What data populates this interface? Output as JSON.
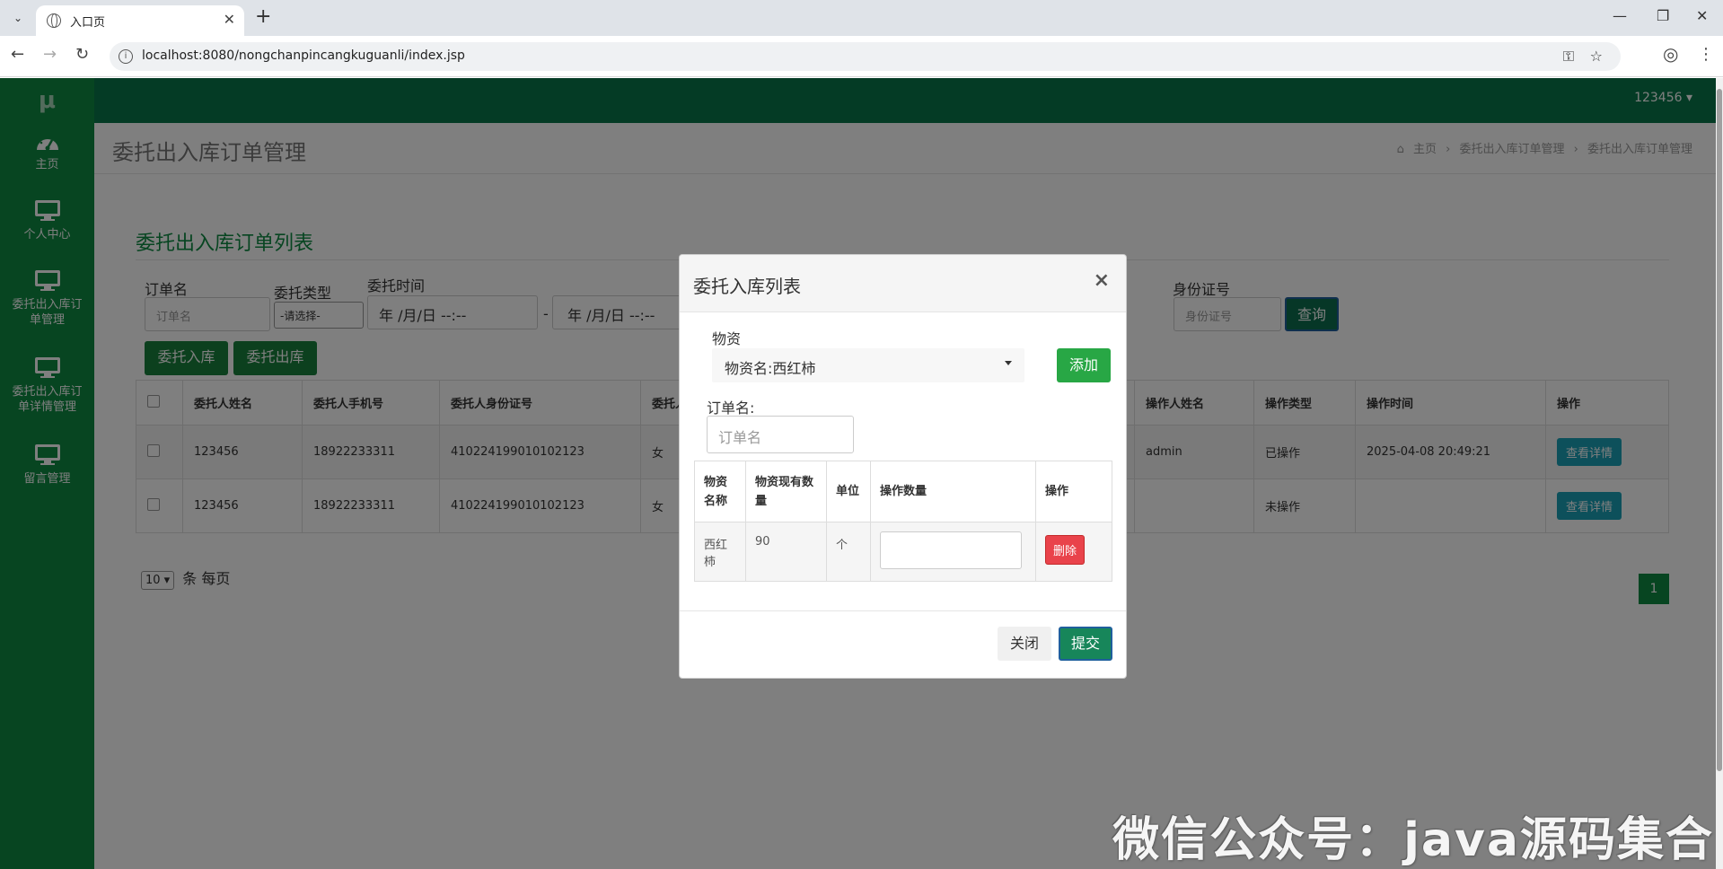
{
  "browser": {
    "tab_title": "入口页",
    "url": "localhost:8080/nongchanpincangkuguanli/index.jsp"
  },
  "sidebar": {
    "logo": "μ",
    "items": [
      {
        "label": "主页"
      },
      {
        "label": "个人中心"
      },
      {
        "label": "委托出入库订单管理"
      },
      {
        "label": "委托出入库订单详情管理"
      },
      {
        "label": "留言管理"
      }
    ]
  },
  "header": {
    "username": "123456 ▾"
  },
  "page": {
    "title": "委托出入库订单管理",
    "breadcrumb": [
      "主页",
      "委托出入库订单管理",
      "委托出入库订单管理"
    ]
  },
  "panel": {
    "title": "委托出入库订单列表",
    "filters": {
      "order_label": "订单名",
      "order_placeholder": "订单名",
      "type_label": "委托类型",
      "type_value": "-请选择-",
      "time_label": "委托时间",
      "time_start": "年 /月/日  --:--",
      "time_end": "年 /月/日  --:--",
      "time_sep": "-",
      "idcard_label": "身份证号",
      "idcard_placeholder": "身份证号",
      "query": "查询"
    },
    "actions": {
      "in": "委托入库",
      "out": "委托出库"
    },
    "columns": [
      "委托人姓名",
      "委托人手机号",
      "委托人身份证号",
      "委托人",
      "操作人姓名",
      "操作类型",
      "操作时间",
      "操作"
    ],
    "rows": [
      {
        "name": "123456",
        "phone": "18922233311",
        "idcard": "410224199010102123",
        "gender": "女",
        "operator": "admin",
        "op_type": "已操作",
        "op_time": "2025-04-08 20:49:21",
        "action": "查看详情"
      },
      {
        "name": "123456",
        "phone": "18922233311",
        "idcard": "410224199010102123",
        "gender": "女",
        "operator": "",
        "op_type": "未操作",
        "op_time": "",
        "action": "查看详情"
      }
    ],
    "pager": {
      "size": "10 ▾",
      "suffix": "条 每页",
      "page": "1"
    }
  },
  "modal": {
    "title": "委托入库列表",
    "material_label": "物资",
    "material_value": "物资名:西红柿",
    "add": "添加",
    "order_label": "订单名:",
    "order_placeholder": "订单名",
    "columns": [
      "物资名称",
      "物资现有数量",
      "单位",
      "操作数量",
      "操作"
    ],
    "rows": [
      {
        "name": "西红柿",
        "qty": "90",
        "unit": "个",
        "op": "删除"
      }
    ],
    "close": "关闭",
    "submit": "提交"
  },
  "watermark": "微信公众号：java源码集合"
}
